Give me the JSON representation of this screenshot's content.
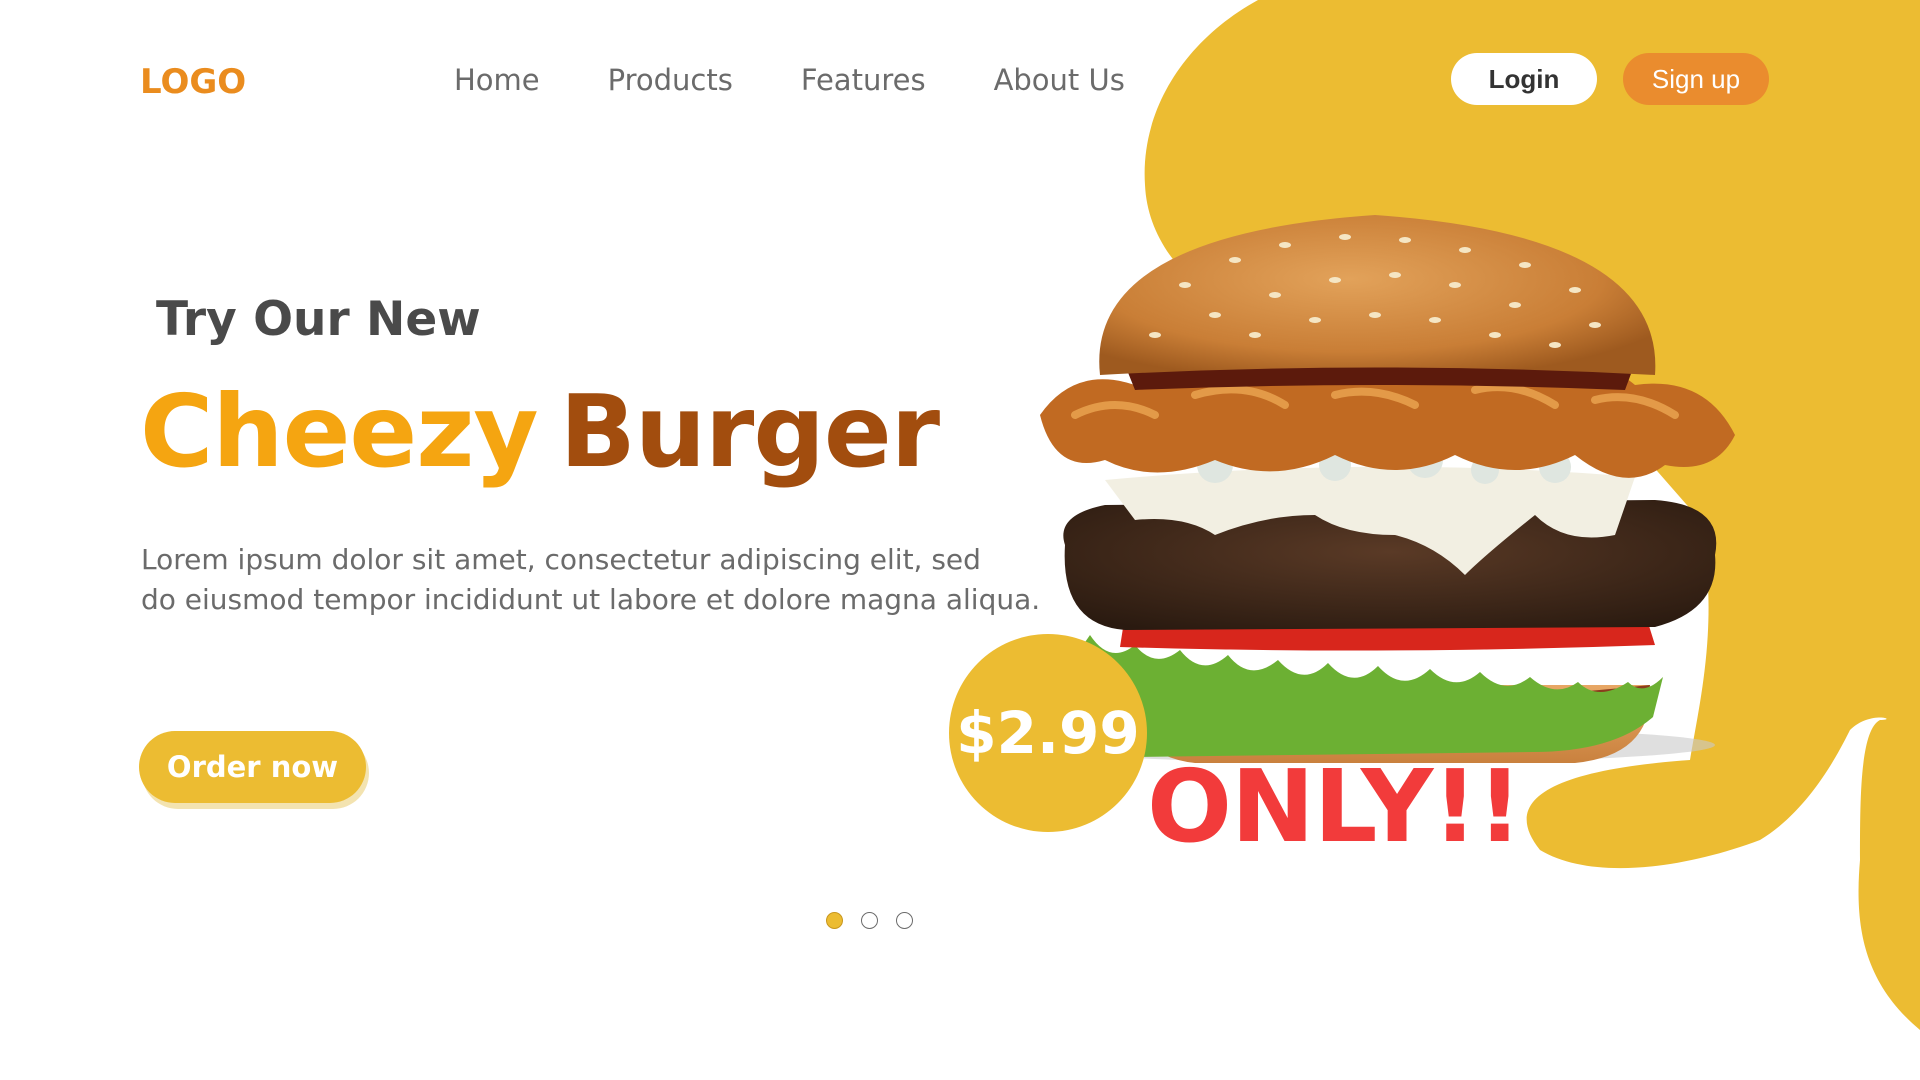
{
  "header": {
    "logo": "LOGO",
    "nav": [
      "Home",
      "Products",
      "Features",
      "About Us"
    ],
    "login_label": "Login",
    "signup_label": "Sign up"
  },
  "hero": {
    "kicker": "Try Our New",
    "headline_word1": "Cheezy",
    "headline_word2": "Burger",
    "description_line1": "Lorem ipsum dolor sit amet, consectetur adipiscing elit, sed",
    "description_line2": "do eiusmod tempor incididunt ut labore et dolore magna aliqua.",
    "order_label": "Order now",
    "price": "$2.99",
    "only_text": "ONLY!!"
  },
  "carousel": {
    "slides": 3,
    "active_index": 0
  },
  "colors": {
    "brand_yellow": "#ecbc32",
    "logo_orange": "#ea8c1e",
    "signup_orange": "#ea8c2e",
    "headline_orange": "#f5a511",
    "headline_brown": "#a24d0e",
    "only_red": "#f23b3b"
  }
}
